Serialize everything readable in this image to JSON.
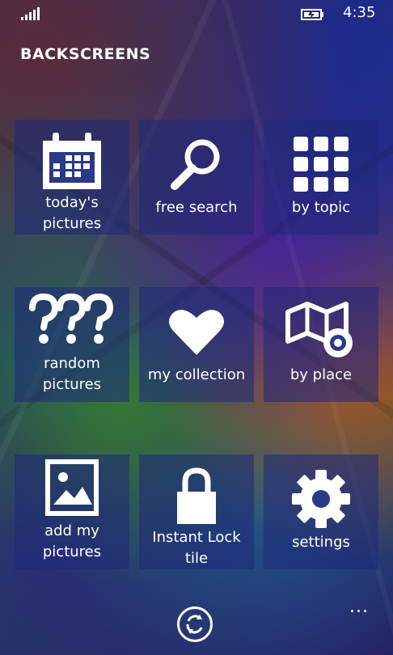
{
  "status_bar": {
    "time": "4:35",
    "signal_icon": "signal-bars-icon",
    "battery_icon": "battery-charging-icon"
  },
  "app": {
    "title": "BACKSCREENS"
  },
  "tiles": [
    {
      "label": "today's pictures",
      "icon": "calendar-icon"
    },
    {
      "label": "free search",
      "icon": "magnifier-icon"
    },
    {
      "label": "by topic",
      "icon": "grid-icon"
    },
    {
      "label": "random pictures",
      "label_line1": "random",
      "label_line2": "pictures",
      "icon": "question-marks-icon"
    },
    {
      "label": "my collection",
      "icon": "heart-icon"
    },
    {
      "label": "by place",
      "icon": "map-pin-icon"
    },
    {
      "label": "add my pictures",
      "label_line1": "add my",
      "label_line2": "pictures",
      "icon": "picture-icon"
    },
    {
      "label": "Instant Lock tile",
      "icon": "lock-icon"
    },
    {
      "label": "settings",
      "icon": "gear-icon"
    }
  ],
  "app_bar": {
    "sync_icon": "refresh-icon",
    "more_label": "..."
  },
  "colors": {
    "tile_bg": "#1e2878",
    "text": "#ffffff"
  }
}
